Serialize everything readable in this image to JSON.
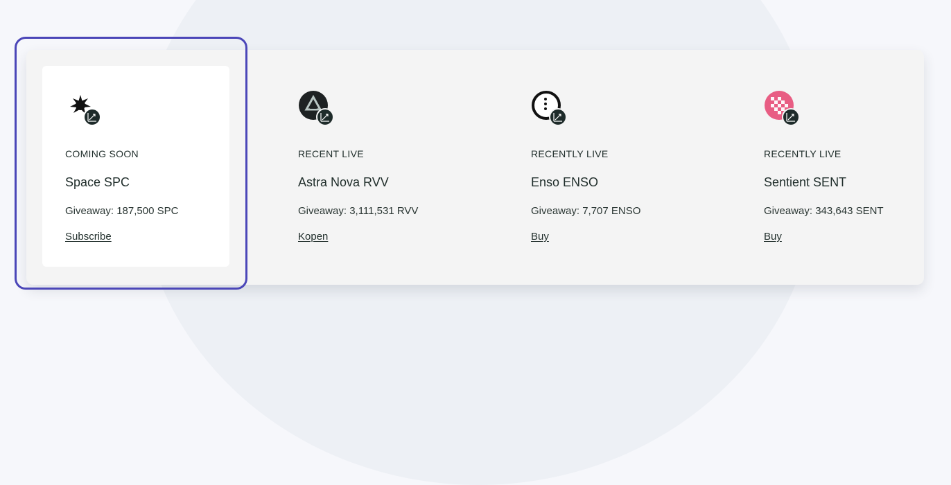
{
  "cards": [
    {
      "status": "COMING SOON",
      "name": "Space SPC",
      "giveaway": "Giveaway: 187,500 SPC",
      "action": "Subscribe",
      "icon": "space-spc-token-icon",
      "selected": true
    },
    {
      "status": "RECENT LIVE",
      "name": "Astra Nova RVV",
      "giveaway": "Giveaway: 3,111,531 RVV",
      "action": "Kopen",
      "icon": "astra-nova-rvv-token-icon",
      "selected": false
    },
    {
      "status": "RECENTLY LIVE",
      "name": "Enso ENSO",
      "giveaway": "Giveaway: 7,707 ENSO",
      "action": "Buy",
      "icon": "enso-token-icon",
      "selected": false
    },
    {
      "status": "RECENTLY LIVE",
      "name": "Sentient SENT",
      "giveaway": "Giveaway: 343,643 SENT",
      "action": "Buy",
      "icon": "sentient-sent-token-icon",
      "selected": false
    }
  ],
  "colors": {
    "highlight": "#4b46b8",
    "panel": "#f4f4f4",
    "active_card": "#ffffff",
    "sentient_pink": "#e85d83"
  }
}
